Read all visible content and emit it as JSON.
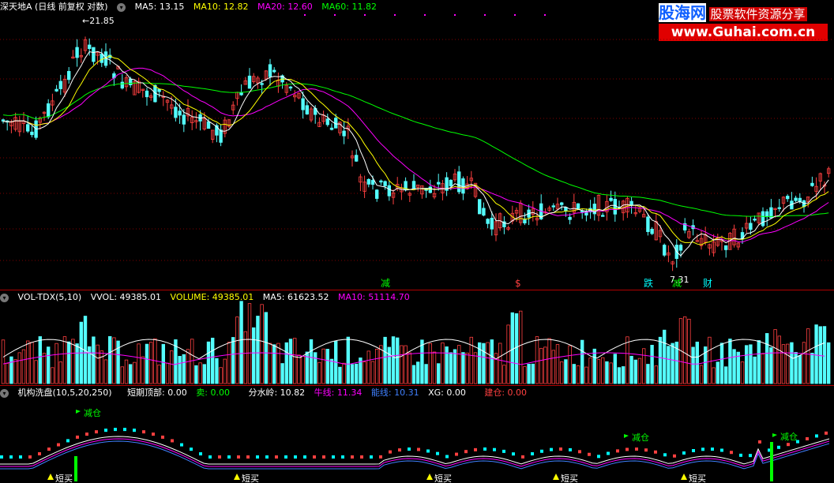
{
  "main_header": {
    "title": "深天地A (日线 前复权 对数)",
    "ma5": "MA5: 13.15",
    "ma10": "MA10: 12.82",
    "ma20": "MA20: 12.60",
    "ma60": "MA60: 11.82",
    "high_label": "21.85",
    "low_label": "7.31"
  },
  "event_labels": [
    "减",
    "$",
    "跌",
    "减",
    "财"
  ],
  "vol_header": {
    "name": "VOL-TDX(5,10)",
    "vvol": "VVOL: 49385.01",
    "volume": "VOLUME: 49385.01",
    "ma5": "MA5: 61623.52",
    "ma10": "MA10: 51114.70"
  },
  "ind_header": {
    "name": "机构洗盘(10,5,20,250)",
    "short_top": "短期顶部: 0.00",
    "sell": "卖: 0.00",
    "watershed": "分水岭: 10.82",
    "bull_line": "牛线: 11.34",
    "energy_line": "能线: 10.31",
    "xg": "XG: 0.00",
    "build_position": "建仓: 0.00"
  },
  "signals": {
    "reduce": "减仓",
    "short_buy": "短买"
  },
  "watermark": {
    "logo": "股海网",
    "slogan": "股票软件资源分享",
    "url": "www.Guhai.com.cn"
  },
  "colors": {
    "up": "#ff4040",
    "down": "#54fcfc",
    "ma5": "#ffffff",
    "ma10": "#ffff00",
    "ma20": "#ff00ff",
    "ma60": "#00ff00"
  }
}
